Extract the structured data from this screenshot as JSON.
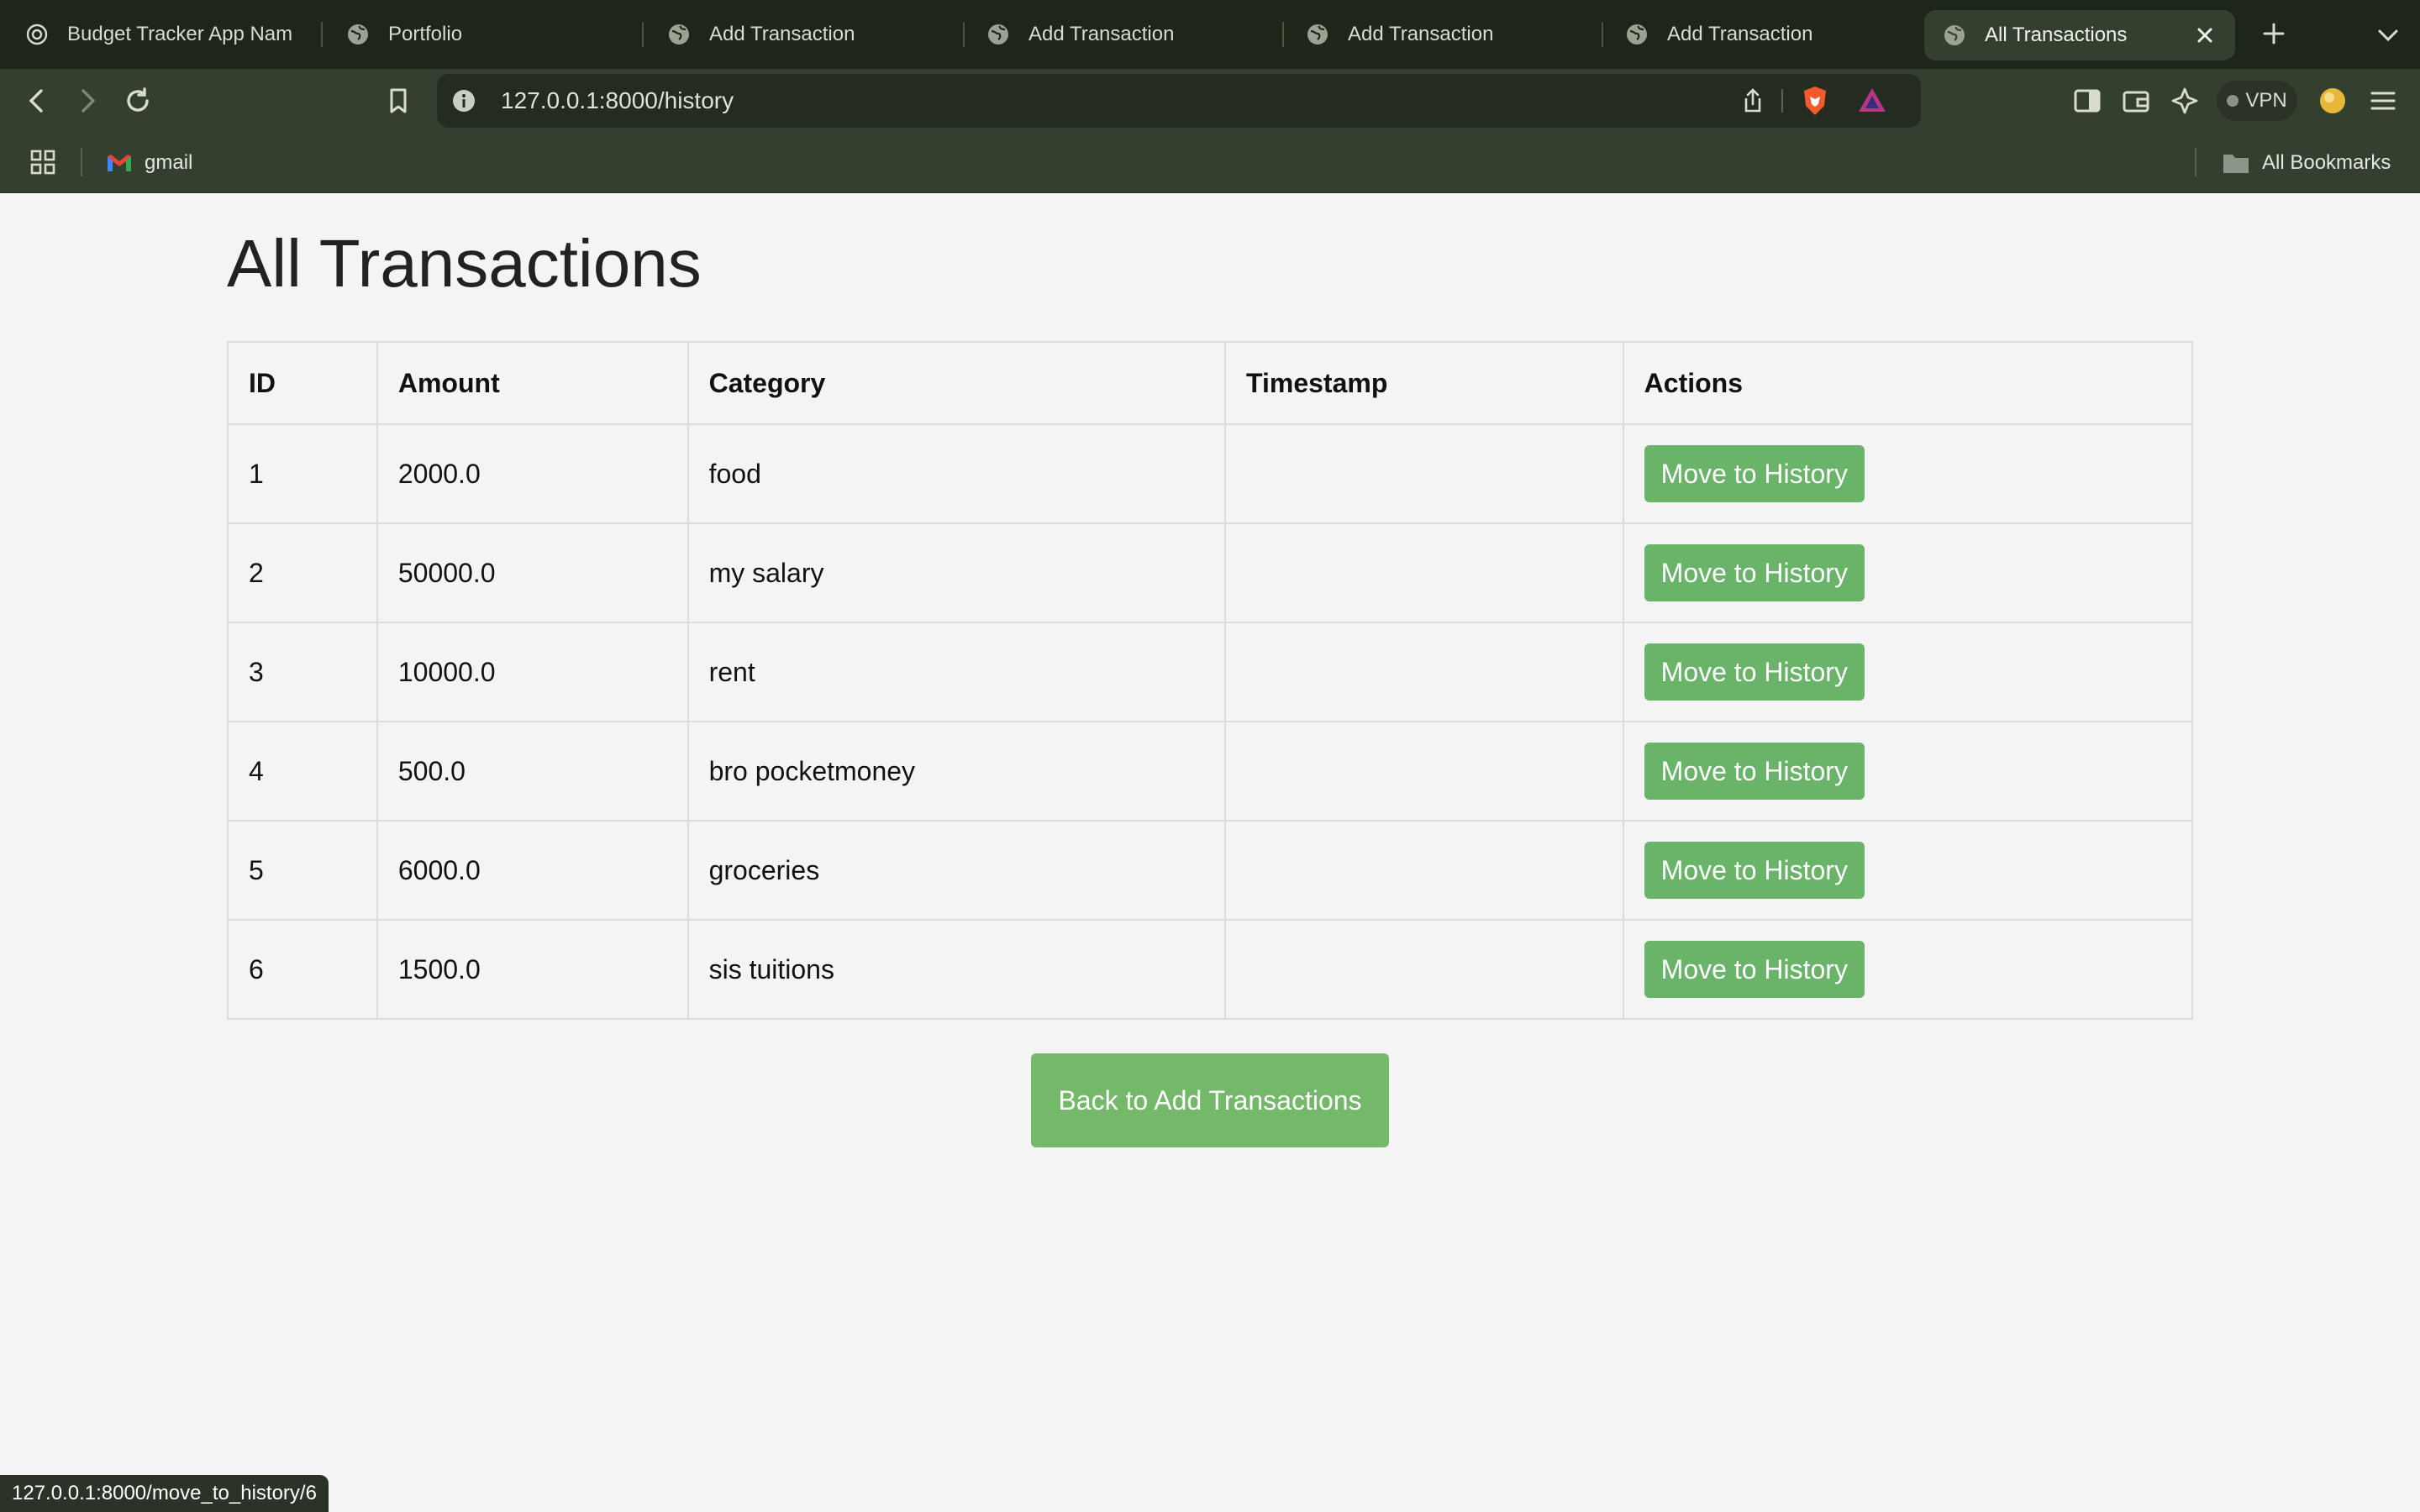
{
  "browser": {
    "tabs": [
      {
        "title": "Budget Tracker App Nam",
        "icon": "openai-icon",
        "active": false
      },
      {
        "title": "Portfolio",
        "icon": "globe-icon",
        "active": false
      },
      {
        "title": "Add Transaction",
        "icon": "globe-icon",
        "active": false
      },
      {
        "title": "Add Transaction",
        "icon": "globe-icon",
        "active": false
      },
      {
        "title": "Add Transaction",
        "icon": "globe-icon",
        "active": false
      },
      {
        "title": "Add Transaction",
        "icon": "globe-icon",
        "active": false
      },
      {
        "title": "All Transactions",
        "icon": "globe-icon",
        "active": true
      }
    ],
    "url": "127.0.0.1:8000/history",
    "vpn_label": "VPN",
    "bookmarks": {
      "gmail": "gmail",
      "all_bookmarks": "All Bookmarks"
    },
    "status_url": "127.0.0.1:8000/move_to_history/6"
  },
  "page": {
    "title": "All Transactions",
    "table": {
      "headers": [
        "ID",
        "Amount",
        "Category",
        "Timestamp",
        "Actions"
      ],
      "rows": [
        {
          "id": "1",
          "amount": "2000.0",
          "category": "food",
          "timestamp": "",
          "action": "Move to History"
        },
        {
          "id": "2",
          "amount": "50000.0",
          "category": "my salary",
          "timestamp": "",
          "action": "Move to History"
        },
        {
          "id": "3",
          "amount": "10000.0",
          "category": "rent",
          "timestamp": "",
          "action": "Move to History"
        },
        {
          "id": "4",
          "amount": "500.0",
          "category": "bro pocketmoney",
          "timestamp": "",
          "action": "Move to History"
        },
        {
          "id": "5",
          "amount": "6000.0",
          "category": "groceries",
          "timestamp": "",
          "action": "Move to History"
        },
        {
          "id": "6",
          "amount": "1500.0",
          "category": "sis tuitions",
          "timestamp": "",
          "action": "Move to History"
        }
      ]
    },
    "back_button": "Back to Add Transactions"
  },
  "colors": {
    "chrome_dark": "#1e2519",
    "chrome": "#353f2f",
    "button_green": "#6ab46a",
    "page_bg": "#f4f4f4"
  }
}
